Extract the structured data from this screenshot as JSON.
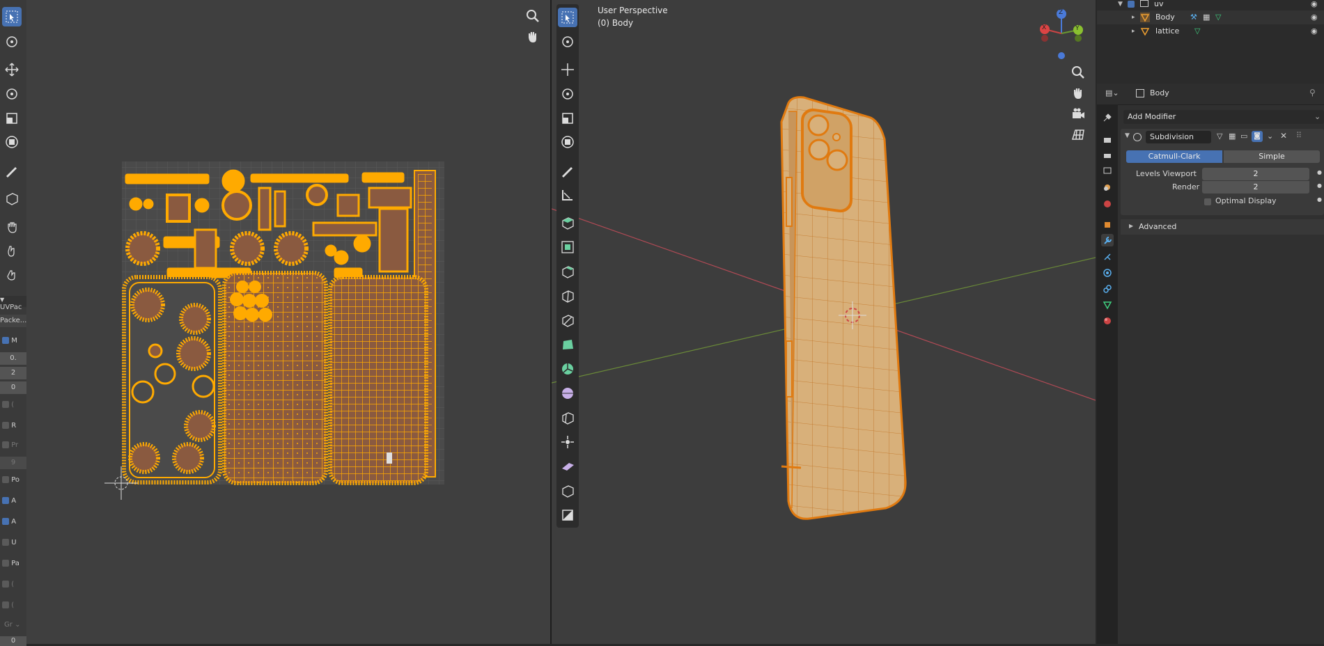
{
  "uv_editor": {
    "sidebar_panel_title": "UVPac",
    "sidebar_fields": [
      "Packe...",
      "M",
      "0.",
      "2",
      "0",
      "(",
      "R",
      "Pr",
      "9",
      "Po",
      "A",
      "A",
      "U",
      "Pa",
      "(",
      "(",
      "Gr",
      "0"
    ],
    "checkbox_states": {
      "M": true,
      "R": false,
      "Pr": false,
      "Po": false,
      "A1": true,
      "A2": true,
      "U": false,
      "Pa": false
    }
  },
  "viewport": {
    "view_name": "User Perspective",
    "object_label": "(0) Body",
    "gizmo_axes": [
      "X",
      "Y",
      "Z"
    ]
  },
  "outliner": {
    "items": [
      {
        "label": "uv",
        "type": "collection"
      },
      {
        "label": "Body",
        "type": "mesh"
      },
      {
        "label": "lattice",
        "type": "lattice"
      }
    ]
  },
  "properties": {
    "object_name": "Body",
    "add_modifier_label": "Add Modifier",
    "modifier_name": "Subdivision",
    "mode_options": [
      "Catmull-Clark",
      "Simple"
    ],
    "selected_mode": "Catmull-Clark",
    "levels_viewport_label": "Levels Viewport",
    "levels_viewport_value": "2",
    "render_label": "Render",
    "render_value": "2",
    "optimal_display_label": "Optimal Display",
    "optimal_display_checked": false,
    "advanced_label": "Advanced"
  },
  "colors": {
    "accent": "#4772b3",
    "selection": "#ffaa00",
    "uv_fill": "#8a5a40",
    "mesh_fill": "#d8b07a",
    "x_axis": "#b04a55",
    "y_axis": "#6a8a38"
  }
}
